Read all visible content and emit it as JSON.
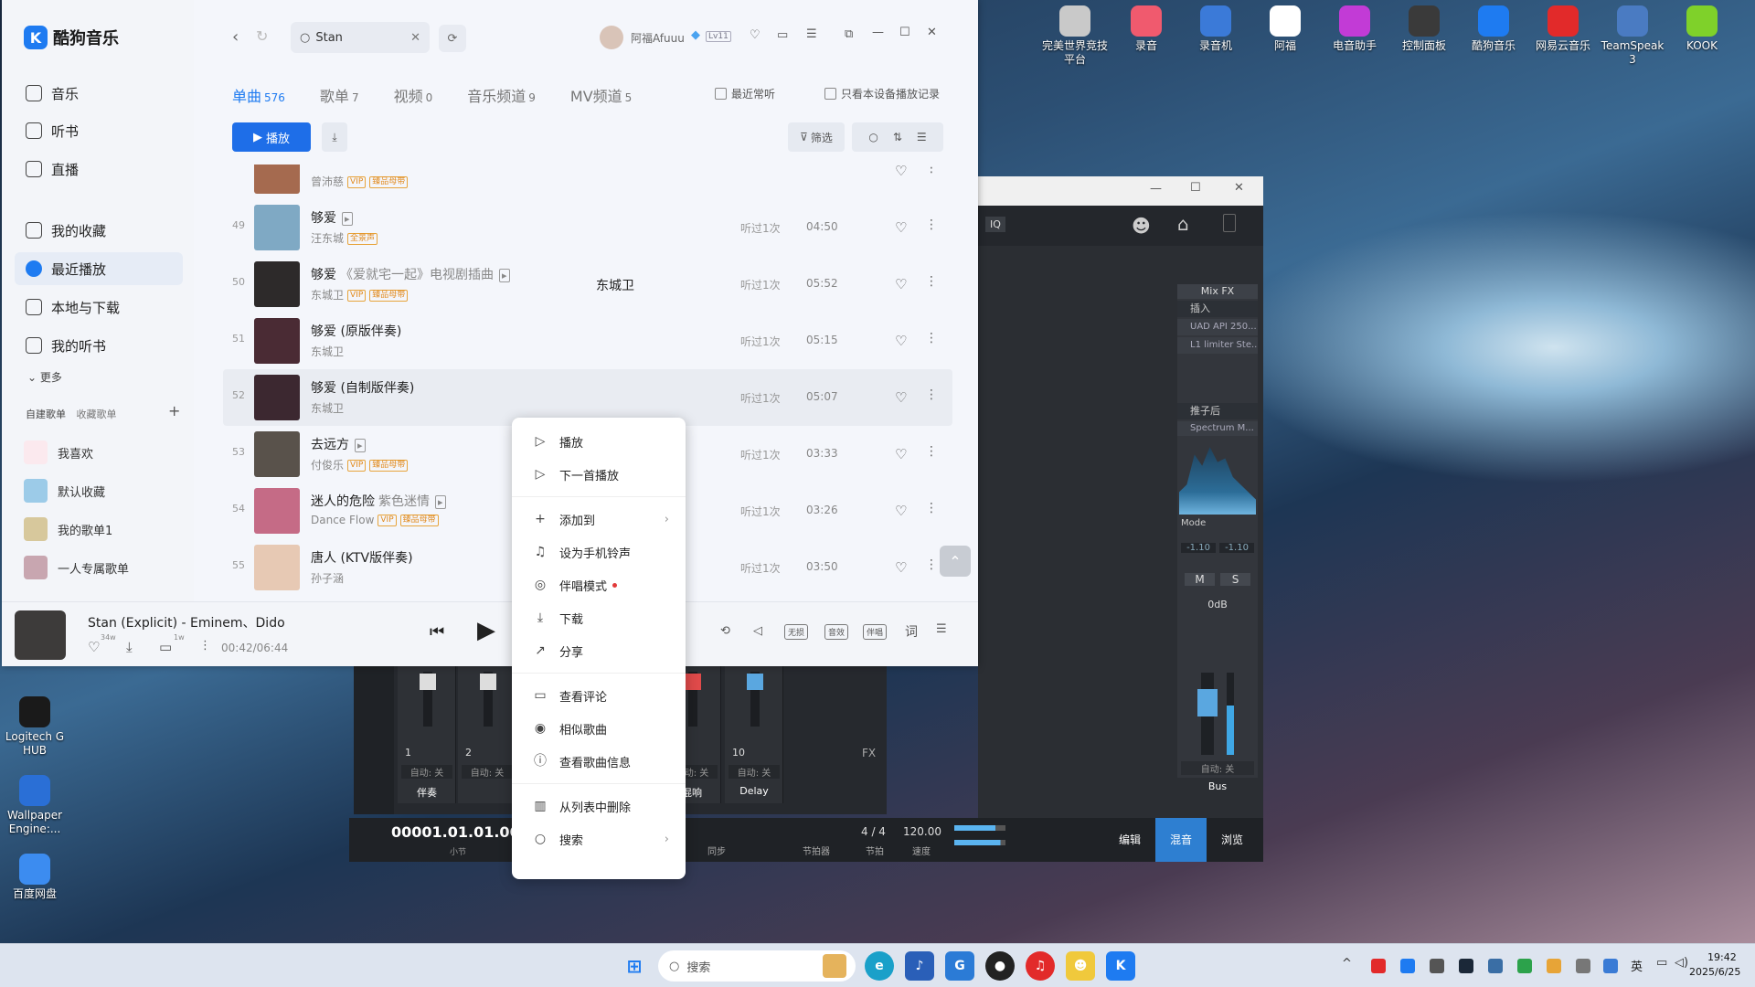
{
  "desktop": {
    "icons_top": [
      {
        "label": "完美世界竞技平台",
        "color": "#c9c9c9"
      },
      {
        "label": "录音",
        "color": "#f05a6e"
      },
      {
        "label": "录音机",
        "color": "#3b7ad8"
      },
      {
        "label": "阿福",
        "color": "#ffffff"
      },
      {
        "label": "电音助手",
        "color": "#c23bd6"
      },
      {
        "label": "控制面板",
        "color": "#3a3a3a"
      },
      {
        "label": "酷狗音乐",
        "color": "#1e7bf1"
      },
      {
        "label": "网易云音乐",
        "color": "#e22a2a"
      },
      {
        "label": "TeamSpeak 3",
        "color": "#4a7bc2"
      },
      {
        "label": "KOOK",
        "color": "#7fd12a"
      }
    ],
    "icons_left": [
      {
        "label": "Logitech G HUB",
        "color": "#1a1a1a"
      },
      {
        "label": "Wallpaper Engine:...",
        "color": "#2a6fd6"
      },
      {
        "label": "百度网盘",
        "color": "#3c8cf0"
      }
    ]
  },
  "kugou": {
    "app_name": "酷狗音乐",
    "search_value": "Stan",
    "user_name": "阿福Afuuu",
    "level": "Lv11",
    "nav": [
      {
        "label": "音乐",
        "icon": "music-icon",
        "active": false
      },
      {
        "label": "听书",
        "icon": "book-icon",
        "active": false
      },
      {
        "label": "直播",
        "icon": "live-icon",
        "active": false
      },
      {
        "label": "我的收藏",
        "icon": "heart-icon",
        "active": false
      },
      {
        "label": "最近播放",
        "icon": "clock-icon",
        "active": true
      },
      {
        "label": "本地与下载",
        "icon": "download-icon",
        "active": false
      },
      {
        "label": "我的听书",
        "icon": "book-icon",
        "active": false
      }
    ],
    "more_label": "更多",
    "playlist_tabs": {
      "created": "自建歌单",
      "collected": "收藏歌单"
    },
    "playlists": [
      {
        "label": "我喜欢",
        "color": "#fbe9ee"
      },
      {
        "label": "默认收藏",
        "color": "#9ccbe8"
      },
      {
        "label": "我的歌单1",
        "color": "#d7c89c"
      },
      {
        "label": "一人专属歌单",
        "color": "#c8a6b0"
      }
    ],
    "tabs": [
      {
        "label": "单曲",
        "count": "576",
        "active": true
      },
      {
        "label": "歌单",
        "count": "7",
        "active": false
      },
      {
        "label": "视频",
        "count": "0",
        "active": false
      },
      {
        "label": "音乐频道",
        "count": "9",
        "active": false
      },
      {
        "label": "MV频道",
        "count": "5",
        "active": false
      }
    ],
    "filter_recent": "最近常听",
    "filter_device": "只看本设备播放记录",
    "play_label": "播放",
    "filter_label": "筛选",
    "rows": [
      {
        "num": "",
        "title": "",
        "artist": "曾沛慈",
        "badges": [
          "VIP",
          "臻品母带"
        ],
        "album": "",
        "plays": "",
        "dur": "",
        "cover": "#a56a4f"
      },
      {
        "num": "49",
        "title": "够爱",
        "sub": "",
        "artist": "汪东城",
        "badges": [
          "全景声"
        ],
        "album": "",
        "plays": "听过1次",
        "dur": "04:50",
        "cover": "#7fa9c4",
        "mv": true
      },
      {
        "num": "50",
        "title": "够爱",
        "sub": "《爱就宅一起》电视剧插曲",
        "artist": "东城卫",
        "badges": [
          "VIP",
          "臻品母带"
        ],
        "album": "东城卫",
        "plays": "听过1次",
        "dur": "05:52",
        "cover": "#2d2a2a",
        "mv": true
      },
      {
        "num": "51",
        "title": "够爱 (原版伴奏)",
        "sub": "",
        "artist": "东城卫",
        "badges": [],
        "album": "",
        "plays": "听过1次",
        "dur": "05:15",
        "cover": "#4a2b34"
      },
      {
        "num": "52",
        "title": "够爱 (自制版伴奏)",
        "sub": "",
        "artist": "东城卫",
        "badges": [],
        "album": "",
        "plays": "听过1次",
        "dur": "05:07",
        "cover": "#3c2830",
        "hl": true
      },
      {
        "num": "53",
        "title": "去远方",
        "sub": "",
        "artist": "付俊乐",
        "badges": [
          "VIP",
          "臻品母带"
        ],
        "album": "",
        "plays": "听过1次",
        "dur": "03:33",
        "cover": "#59524b",
        "mv": true
      },
      {
        "num": "54",
        "title": "迷人的危险",
        "sub": "紫色迷情",
        "artist": "Dance Flow",
        "badges": [
          "VIP",
          "臻品母带"
        ],
        "album": "",
        "plays": "听过1次",
        "dur": "03:26",
        "cover": "#c56b86",
        "mv": true
      },
      {
        "num": "55",
        "title": "唐人 (KTV版伴奏)",
        "sub": "",
        "artist": "孙子涵",
        "badges": [],
        "album": "",
        "plays": "听过1次",
        "dur": "03:50",
        "cover": "#e7c9b4"
      }
    ],
    "player": {
      "song": "Stan (Explicit) - Eminem、Dido",
      "time": "00:42/06:44",
      "like_count": "34w",
      "comment_count": "1w",
      "buttons": [
        "无损",
        "音效",
        "伴唱"
      ],
      "lyrics": "词"
    }
  },
  "context_menu": [
    {
      "label": "播放",
      "icon": "play-icon",
      "sep_after": false
    },
    {
      "label": "下一首播放",
      "icon": "next-play-icon",
      "sep_after": true
    },
    {
      "label": "添加到",
      "icon": "plus-icon",
      "arrow": true,
      "sep_after": false
    },
    {
      "label": "设为手机铃声",
      "icon": "bell-icon",
      "sep_after": false
    },
    {
      "label": "伴唱模式",
      "icon": "karaoke-icon",
      "dot": true,
      "sep_after": false
    },
    {
      "label": "下载",
      "icon": "download-icon",
      "sep_after": false
    },
    {
      "label": "分享",
      "icon": "share-icon",
      "sep_after": true
    },
    {
      "label": "查看评论",
      "icon": "comment-icon",
      "sep_after": false
    },
    {
      "label": "相似歌曲",
      "icon": "similar-icon",
      "sep_after": false
    },
    {
      "label": "查看歌曲信息",
      "icon": "info-icon",
      "sep_after": true
    },
    {
      "label": "从列表中删除",
      "icon": "trash-icon",
      "sep_after": false
    },
    {
      "label": "搜索",
      "icon": "search-icon",
      "arrow": true,
      "sep_after": false
    }
  ],
  "daw": {
    "iq": "IQ",
    "mixfx": "Mix FX",
    "insert": "插入",
    "plugins": [
      "UAD API 250...",
      "L1 limiter Ste..."
    ],
    "post": "推子后",
    "spectrum": "Spectrum M...",
    "mode": "Mode",
    "levels": [
      "-1.10",
      "-1.10"
    ],
    "ms": [
      "M",
      "S"
    ],
    "db": "0dB",
    "auto": "自动: 关",
    "bus": "Bus",
    "channels": [
      {
        "num": "1",
        "name": "伴奏"
      },
      {
        "num": "2",
        "name": ""
      },
      {
        "num": "",
        "name": "果"
      },
      {
        "num": "",
        "name": "混响"
      },
      {
        "num": "10",
        "name": "Delay"
      }
    ],
    "fx": "FX",
    "position": "00001.01.01.00",
    "position_unit": "小节",
    "sync": "同步",
    "metronome": "节拍器",
    "sig": "4 / 4",
    "sig_label": "节拍",
    "tempo": "120.00",
    "tempo_label": "速度",
    "tabs": [
      "编辑",
      "混音",
      "浏览"
    ]
  },
  "taskbar": {
    "search_placeholder": "搜索",
    "time": "19:42",
    "date": "2025/6/25",
    "ime": "英"
  }
}
